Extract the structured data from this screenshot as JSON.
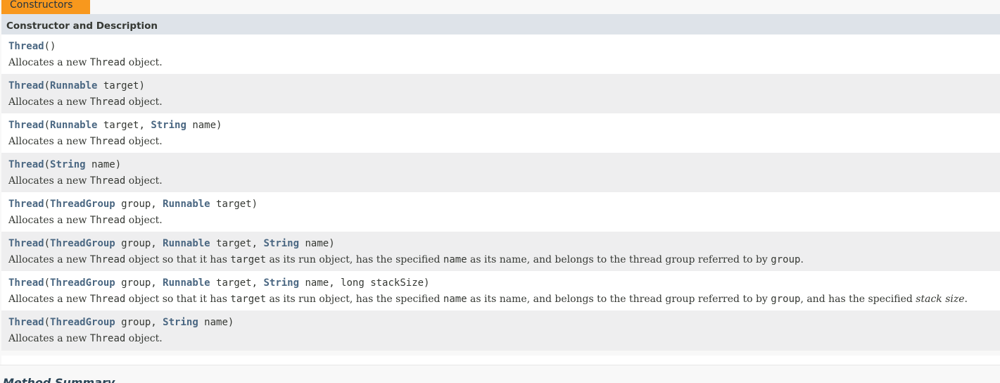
{
  "caption": "Constructors",
  "table_header": "Constructor and Description",
  "rows": [
    {
      "sig": [
        {
          "t": "link",
          "v": "Thread"
        },
        {
          "t": "text",
          "v": "()"
        }
      ],
      "desc": [
        {
          "t": "text",
          "v": "Allocates a new "
        },
        {
          "t": "code",
          "v": "Thread"
        },
        {
          "t": "text",
          "v": " object."
        }
      ]
    },
    {
      "sig": [
        {
          "t": "link",
          "v": "Thread"
        },
        {
          "t": "text",
          "v": "("
        },
        {
          "t": "type",
          "v": "Runnable"
        },
        {
          "t": "text",
          "v": " target)"
        }
      ],
      "desc": [
        {
          "t": "text",
          "v": "Allocates a new "
        },
        {
          "t": "code",
          "v": "Thread"
        },
        {
          "t": "text",
          "v": " object."
        }
      ]
    },
    {
      "sig": [
        {
          "t": "link",
          "v": "Thread"
        },
        {
          "t": "text",
          "v": "("
        },
        {
          "t": "type",
          "v": "Runnable"
        },
        {
          "t": "text",
          "v": " target, "
        },
        {
          "t": "type",
          "v": "String"
        },
        {
          "t": "text",
          "v": " name)"
        }
      ],
      "desc": [
        {
          "t": "text",
          "v": "Allocates a new "
        },
        {
          "t": "code",
          "v": "Thread"
        },
        {
          "t": "text",
          "v": " object."
        }
      ]
    },
    {
      "sig": [
        {
          "t": "link",
          "v": "Thread"
        },
        {
          "t": "text",
          "v": "("
        },
        {
          "t": "type",
          "v": "String"
        },
        {
          "t": "text",
          "v": " name)"
        }
      ],
      "desc": [
        {
          "t": "text",
          "v": "Allocates a new "
        },
        {
          "t": "code",
          "v": "Thread"
        },
        {
          "t": "text",
          "v": " object."
        }
      ]
    },
    {
      "sig": [
        {
          "t": "link",
          "v": "Thread"
        },
        {
          "t": "text",
          "v": "("
        },
        {
          "t": "type",
          "v": "ThreadGroup"
        },
        {
          "t": "text",
          "v": " group, "
        },
        {
          "t": "type",
          "v": "Runnable"
        },
        {
          "t": "text",
          "v": " target)"
        }
      ],
      "desc": [
        {
          "t": "text",
          "v": "Allocates a new "
        },
        {
          "t": "code",
          "v": "Thread"
        },
        {
          "t": "text",
          "v": " object."
        }
      ]
    },
    {
      "sig": [
        {
          "t": "link",
          "v": "Thread"
        },
        {
          "t": "text",
          "v": "("
        },
        {
          "t": "type",
          "v": "ThreadGroup"
        },
        {
          "t": "text",
          "v": " group, "
        },
        {
          "t": "type",
          "v": "Runnable"
        },
        {
          "t": "text",
          "v": " target, "
        },
        {
          "t": "type",
          "v": "String"
        },
        {
          "t": "text",
          "v": " name)"
        }
      ],
      "desc": [
        {
          "t": "text",
          "v": "Allocates a new "
        },
        {
          "t": "code",
          "v": "Thread"
        },
        {
          "t": "text",
          "v": " object so that it has "
        },
        {
          "t": "code",
          "v": "target"
        },
        {
          "t": "text",
          "v": " as its run object, has the specified "
        },
        {
          "t": "code",
          "v": "name"
        },
        {
          "t": "text",
          "v": " as its name, and belongs to the thread group referred to by "
        },
        {
          "t": "code",
          "v": "group"
        },
        {
          "t": "text",
          "v": "."
        }
      ]
    },
    {
      "sig": [
        {
          "t": "link",
          "v": "Thread"
        },
        {
          "t": "text",
          "v": "("
        },
        {
          "t": "type",
          "v": "ThreadGroup"
        },
        {
          "t": "text",
          "v": " group, "
        },
        {
          "t": "type",
          "v": "Runnable"
        },
        {
          "t": "text",
          "v": " target, "
        },
        {
          "t": "type",
          "v": "String"
        },
        {
          "t": "text",
          "v": " name, long stackSize)"
        }
      ],
      "desc": [
        {
          "t": "text",
          "v": "Allocates a new "
        },
        {
          "t": "code",
          "v": "Thread"
        },
        {
          "t": "text",
          "v": " object so that it has "
        },
        {
          "t": "code",
          "v": "target"
        },
        {
          "t": "text",
          "v": " as its run object, has the specified "
        },
        {
          "t": "code",
          "v": "name"
        },
        {
          "t": "text",
          "v": " as its name, and belongs to the thread group referred to by "
        },
        {
          "t": "code",
          "v": "group"
        },
        {
          "t": "text",
          "v": ", and has the specified "
        },
        {
          "t": "em",
          "v": "stack size"
        },
        {
          "t": "text",
          "v": "."
        }
      ]
    },
    {
      "sig": [
        {
          "t": "link",
          "v": "Thread"
        },
        {
          "t": "text",
          "v": "("
        },
        {
          "t": "type",
          "v": "ThreadGroup"
        },
        {
          "t": "text",
          "v": " group, "
        },
        {
          "t": "type",
          "v": "String"
        },
        {
          "t": "text",
          "v": " name)"
        }
      ],
      "desc": [
        {
          "t": "text",
          "v": "Allocates a new "
        },
        {
          "t": "code",
          "v": "Thread"
        },
        {
          "t": "text",
          "v": " object."
        }
      ]
    }
  ],
  "next_heading": "Method Summary",
  "colors": {
    "caption_bg": "#f8981d",
    "header_bg": "#dee3e9",
    "alt_row_bg": "#eeeeef",
    "link": "#4a6782"
  }
}
